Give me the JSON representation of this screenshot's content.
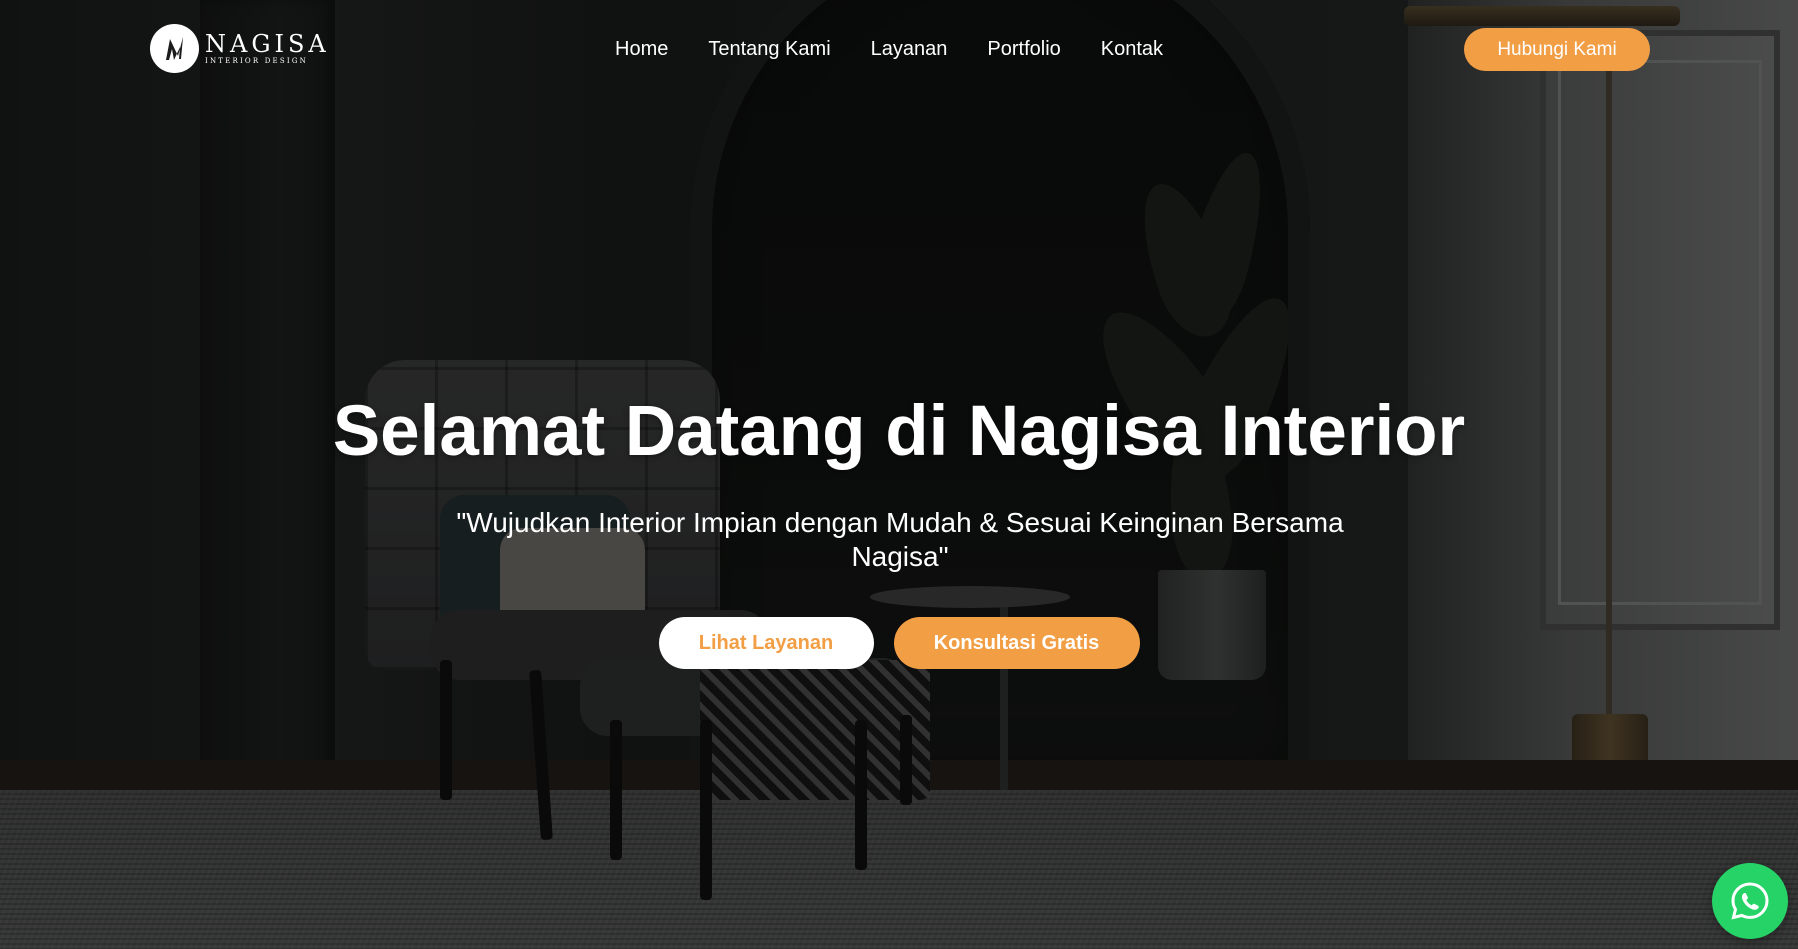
{
  "brand": {
    "name": "NAGISA",
    "tagline": "INTERIOR DESIGN",
    "accent_color": "#f29e45",
    "whatsapp_color": "#25d366"
  },
  "nav": {
    "items": [
      {
        "label": "Home"
      },
      {
        "label": "Tentang Kami"
      },
      {
        "label": "Layanan"
      },
      {
        "label": "Portfolio"
      },
      {
        "label": "Kontak"
      }
    ],
    "cta_label": "Hubungi Kami"
  },
  "hero": {
    "title": "Selamat Datang di Nagisa Interior",
    "subtitle": "\"Wujudkan Interior Impian dengan Mudah & Sesuai Keinginan Bersama Nagisa\"",
    "primary_button": "Lihat Layanan",
    "secondary_button": "Konsultasi Gratis"
  },
  "floating": {
    "icon": "whatsapp-icon"
  }
}
